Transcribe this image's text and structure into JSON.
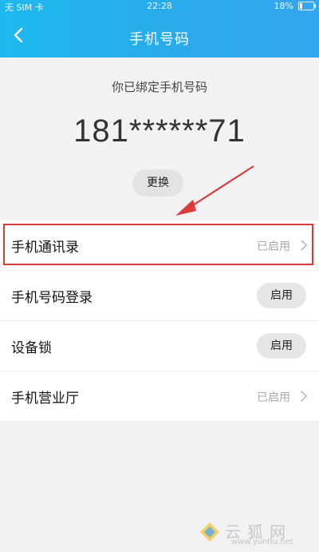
{
  "status_bar": {
    "carrier": "无 SIM 卡",
    "time": "22:28",
    "battery": "18%",
    "battery_level": 0.18
  },
  "header": {
    "back_icon": "chevron-left-icon",
    "title": "手机号码"
  },
  "binding": {
    "label": "你已绑定手机号码",
    "phone": "181******71",
    "change_button": "更换"
  },
  "settings": {
    "rows": [
      {
        "label": "手机通讯录",
        "status": "已启用",
        "control": "chevron"
      },
      {
        "label": "手机号码登录",
        "button": "启用",
        "control": "pill"
      },
      {
        "label": "设备锁",
        "button": "启用",
        "control": "pill"
      },
      {
        "label": "手机营业厅",
        "status": "已启用",
        "control": "chevron"
      }
    ]
  },
  "annotation": {
    "color": "#d93a3a",
    "target": "手机通讯录"
  },
  "watermark": {
    "text": "云狐网",
    "url": "www.yunhu.net"
  },
  "colors": {
    "header_start": "#1fb8ee",
    "header_end": "#35a5f0",
    "background": "#f2f2f4"
  }
}
